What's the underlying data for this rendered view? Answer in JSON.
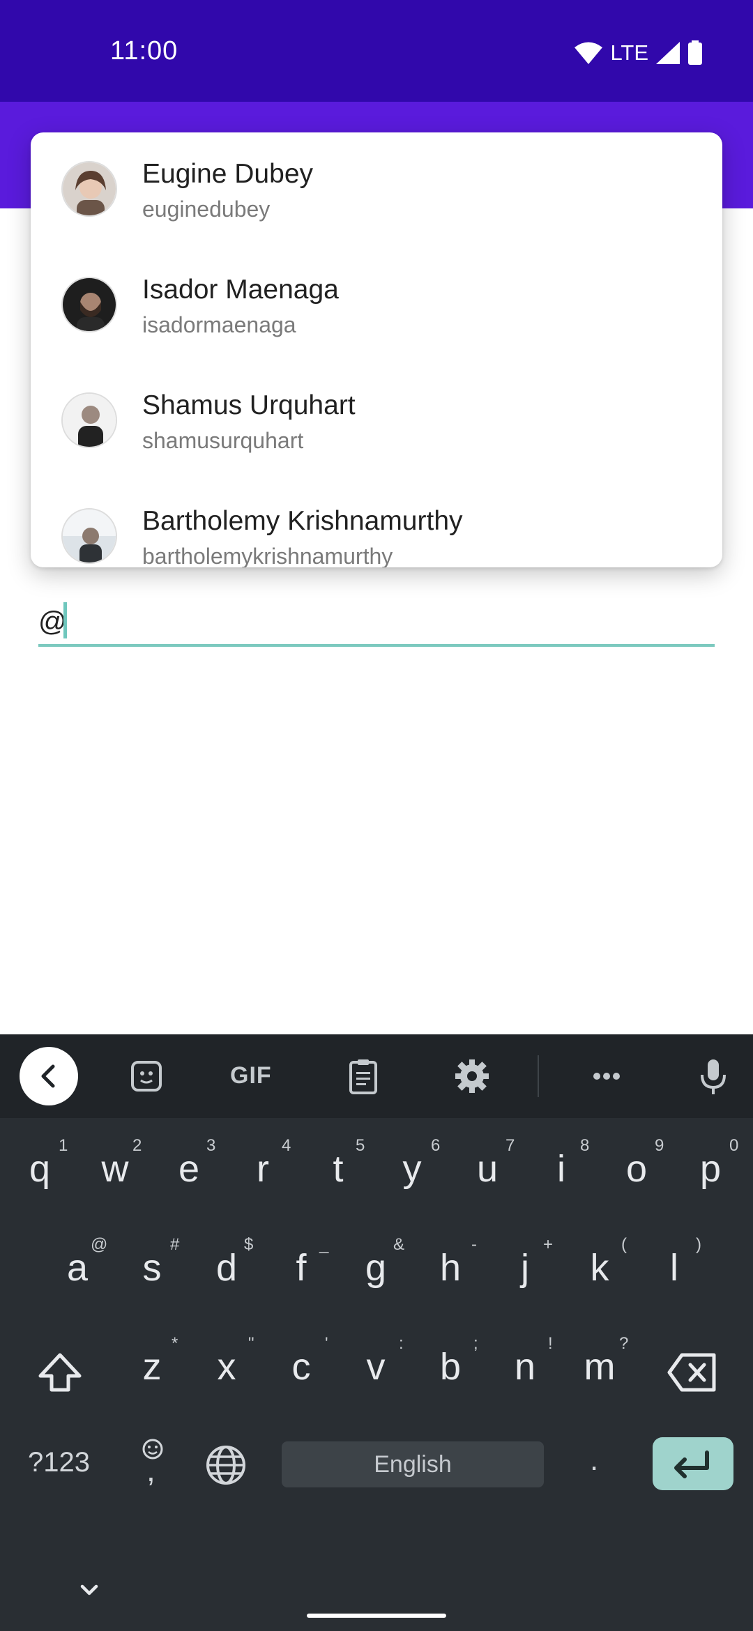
{
  "status": {
    "time": "11:00",
    "network": "LTE"
  },
  "suggestions": [
    {
      "name": "Eugine Dubey",
      "username": "euginedubey"
    },
    {
      "name": "Isador Maenaga",
      "username": "isadormaenaga"
    },
    {
      "name": "Shamus Urquhart",
      "username": "shamusurquhart"
    },
    {
      "name": "Bartholemy Krishnamurthy",
      "username": "bartholemykrishnamurthy"
    }
  ],
  "input": {
    "value": "@"
  },
  "keyboard": {
    "toolbar": {
      "gif_label": "GIF"
    },
    "row1": [
      "q",
      "w",
      "e",
      "r",
      "t",
      "y",
      "u",
      "i",
      "o",
      "p"
    ],
    "row1_hints": [
      "1",
      "2",
      "3",
      "4",
      "5",
      "6",
      "7",
      "8",
      "9",
      "0"
    ],
    "row2": [
      "a",
      "s",
      "d",
      "f",
      "g",
      "h",
      "j",
      "k",
      "l"
    ],
    "row2_hints": [
      "@",
      "#",
      "$",
      "_",
      "&",
      "-",
      "+",
      "(",
      ")"
    ],
    "row3": [
      "z",
      "x",
      "c",
      "v",
      "b",
      "n",
      "m"
    ],
    "row3_hints": [
      "*",
      "\"",
      "'",
      ":",
      ";",
      "!",
      "?"
    ],
    "symbols_label": "?123",
    "comma": ",",
    "space_label": "English",
    "period": "."
  },
  "colors": {
    "status_bar": "#3108ab",
    "app_bar": "#5a1bdc",
    "accent": "#7cc9bf",
    "keyboard_bg": "#292e33"
  }
}
